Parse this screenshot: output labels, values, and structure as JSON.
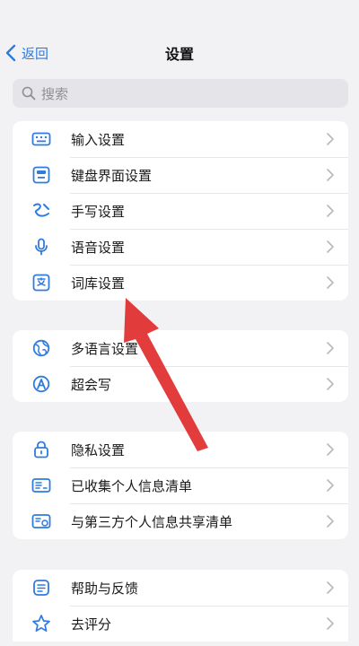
{
  "nav": {
    "back_label": "返回",
    "title": "设置"
  },
  "search": {
    "placeholder": "搜索"
  },
  "groups": [
    {
      "items": [
        {
          "label": "输入设置",
          "icon": "keyboard-icon"
        },
        {
          "label": "键盘界面设置",
          "icon": "keyboard-layout-icon"
        },
        {
          "label": "手写设置",
          "icon": "handwriting-icon"
        },
        {
          "label": "语音设置",
          "icon": "microphone-icon"
        },
        {
          "label": "词库设置",
          "icon": "dictionary-icon"
        }
      ]
    },
    {
      "items": [
        {
          "label": "多语言设置",
          "icon": "globe-icon"
        },
        {
          "label": "超会写",
          "icon": "write-assistant-icon"
        }
      ]
    },
    {
      "items": [
        {
          "label": "隐私设置",
          "icon": "lock-icon"
        },
        {
          "label": "已收集个人信息清单",
          "icon": "id-card-icon"
        },
        {
          "label": "与第三方个人信息共享清单",
          "icon": "share-card-icon"
        }
      ]
    },
    {
      "items": [
        {
          "label": "帮助与反馈",
          "icon": "feedback-icon"
        },
        {
          "label": "去评分",
          "icon": "star-icon"
        }
      ]
    }
  ],
  "colors": {
    "accent": "#2f7be0",
    "annotation_arrow": "#e02b2b"
  }
}
